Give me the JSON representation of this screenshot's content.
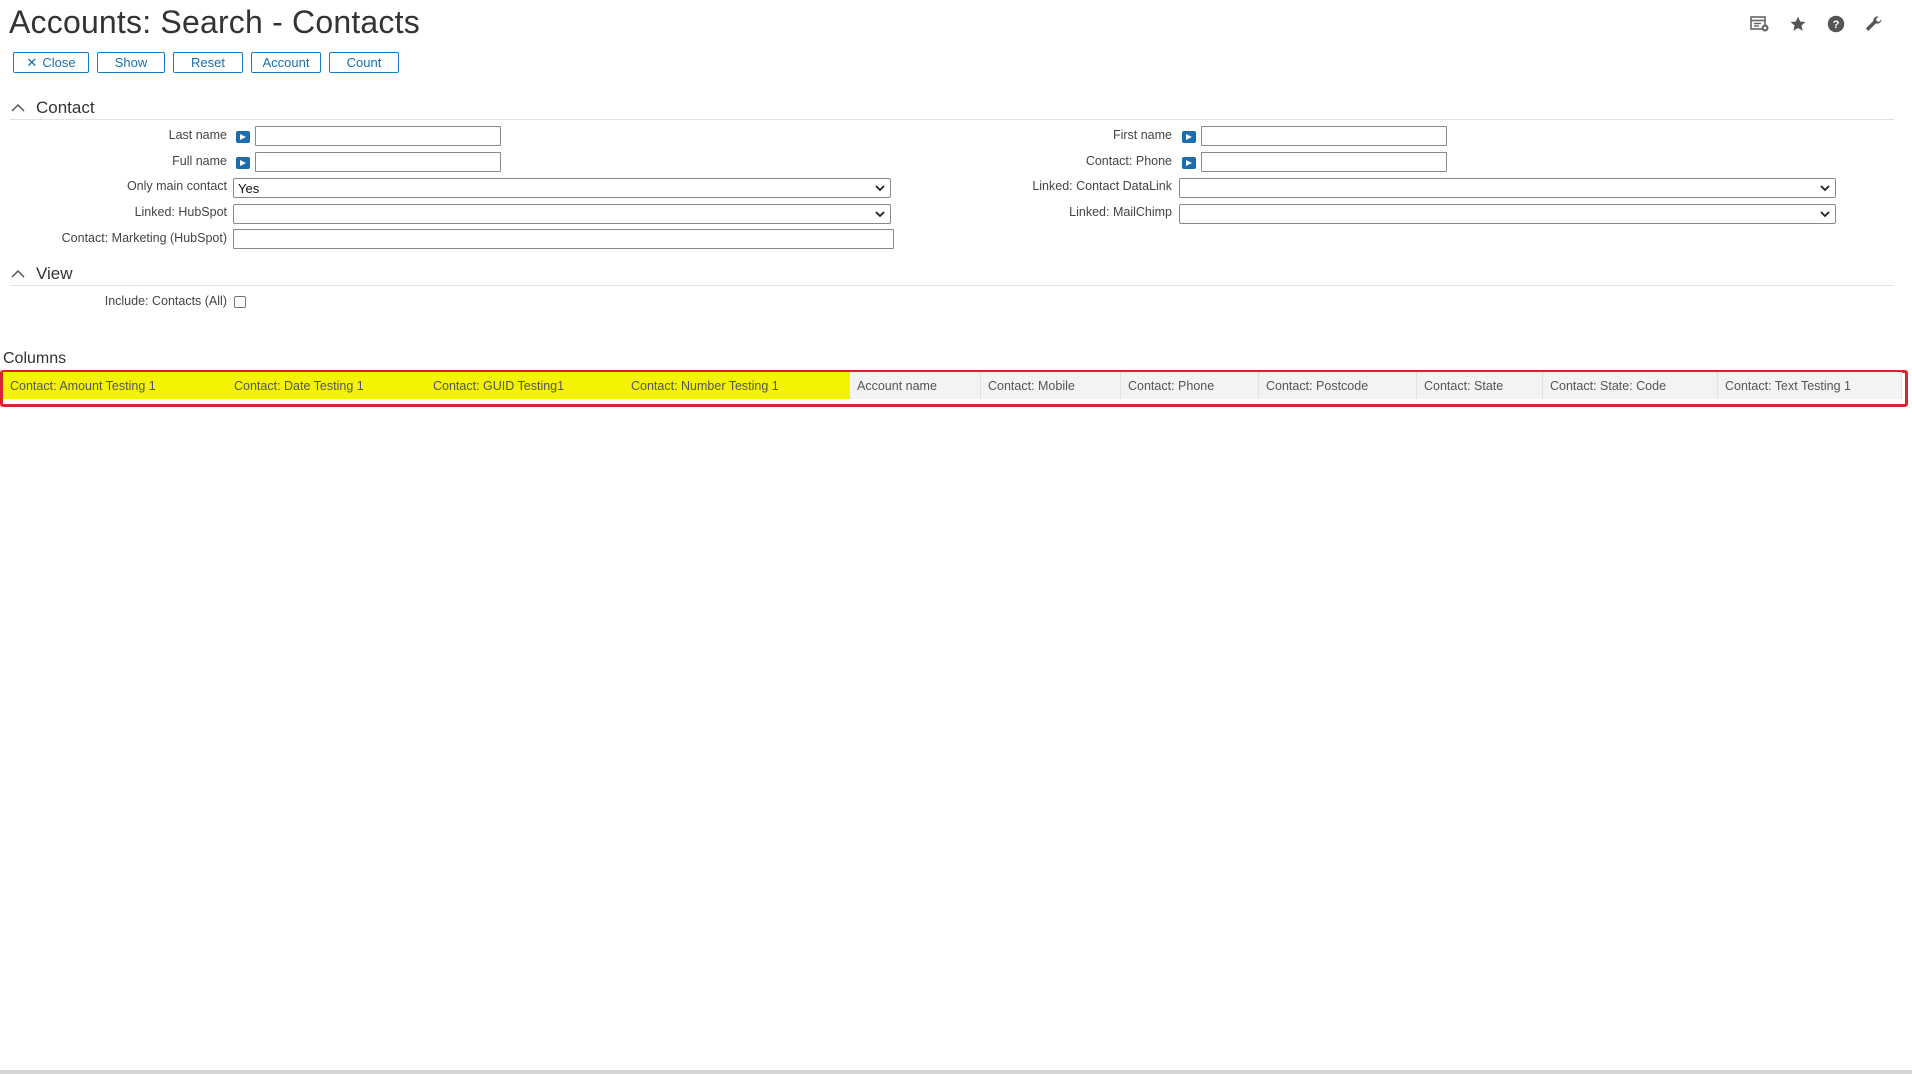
{
  "page": {
    "title": "Accounts: Search - Contacts"
  },
  "toolbar": {
    "close_label": "Close",
    "show_label": "Show",
    "reset_label": "Reset",
    "account_label": "Account",
    "count_label": "Count"
  },
  "top_icons": [
    "view-settings-icon",
    "star-icon",
    "help-icon",
    "wrench-icon"
  ],
  "sections": {
    "contact": {
      "label": "Contact",
      "fields": {
        "last_name": {
          "label": "Last name",
          "value": ""
        },
        "full_name": {
          "label": "Full name",
          "value": ""
        },
        "only_main_contact": {
          "label": "Only main contact",
          "value": "Yes"
        },
        "linked_hubspot": {
          "label": "Linked: HubSpot",
          "value": ""
        },
        "contact_marketing": {
          "label": "Contact: Marketing (HubSpot)",
          "value": ""
        },
        "first_name": {
          "label": "First name",
          "value": ""
        },
        "contact_phone": {
          "label": "Contact: Phone",
          "value": ""
        },
        "linked_contact_datalink": {
          "label": "Linked: Contact DataLink",
          "value": ""
        },
        "linked_mailchimp": {
          "label": "Linked: MailChimp",
          "value": ""
        }
      }
    },
    "view": {
      "label": "View",
      "fields": {
        "include_contacts_all": {
          "label": "Include: Contacts (All)",
          "checked": false
        }
      }
    }
  },
  "columns": {
    "title": "Columns",
    "items": [
      {
        "label": "Contact: Amount Testing 1",
        "highlighted": true
      },
      {
        "label": "Contact: Date Testing 1",
        "highlighted": true
      },
      {
        "label": "Contact: GUID Testing1",
        "highlighted": true
      },
      {
        "label": "Contact: Number Testing 1",
        "highlighted": true
      },
      {
        "label": "Account name",
        "highlighted": false
      },
      {
        "label": "Contact: Mobile",
        "highlighted": false
      },
      {
        "label": "Contact: Phone",
        "highlighted": false
      },
      {
        "label": "Contact: Postcode",
        "highlighted": false
      },
      {
        "label": "Contact: State",
        "highlighted": false
      },
      {
        "label": "Contact: State: Code",
        "highlighted": false
      },
      {
        "label": "Contact: Text Testing 1",
        "highlighted": false
      }
    ]
  },
  "colors": {
    "accent": "#1a6eaf",
    "highlight": "#f4f400",
    "frame": "#d9232e"
  }
}
